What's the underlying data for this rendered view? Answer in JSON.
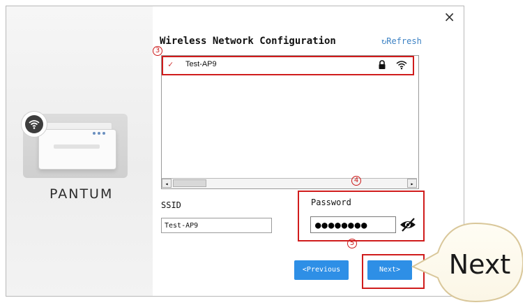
{
  "window": {
    "title": "Wireless Network Configuration",
    "close_label": "×",
    "refresh_label": "Refresh",
    "refresh_icon": "↻"
  },
  "brand": {
    "name": "PANTUM"
  },
  "annotations": {
    "step3": "3",
    "step4": "4",
    "step5": "5"
  },
  "networks": [
    {
      "check": "✓",
      "ssid": "Test-AP9",
      "secured": true,
      "signal": "full"
    }
  ],
  "scrollbar": {
    "left_arrow": "◂",
    "right_arrow": "▸"
  },
  "ssid": {
    "label": "SSID",
    "value": "Test-AP9"
  },
  "password": {
    "label": "Password",
    "masked_value": "●●●●●●●●"
  },
  "buttons": {
    "previous": "<Previous",
    "next": "Next>"
  },
  "callout": {
    "text": "Next"
  },
  "colors": {
    "accent": "#2e8fe6",
    "annotation": "#d01c1c",
    "refresh": "#3d82c4"
  }
}
